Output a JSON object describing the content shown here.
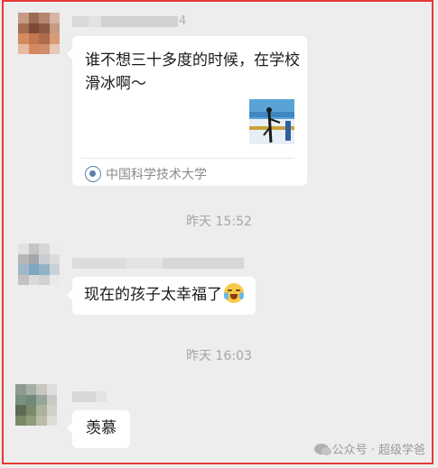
{
  "messages": [
    {
      "sender_suffix": "4",
      "card": {
        "title": "谁不想三十多度的时候，在学校滑冰啊～",
        "source": "中国科学技术大学"
      }
    },
    {
      "text": "现在的孩子太幸福了"
    },
    {
      "text": "羡慕"
    }
  ],
  "timestamps": [
    "昨天 15:52",
    "昨天 16:03"
  ],
  "watermark": "公众号 · 超级学爸",
  "colors": {
    "background": "#ededed",
    "bubble": "#ffffff",
    "highlight_border": "#e53935"
  },
  "icons": [
    "school-logo-icon",
    "crying-laughing-emoji-icon",
    "wechat-icon"
  ]
}
